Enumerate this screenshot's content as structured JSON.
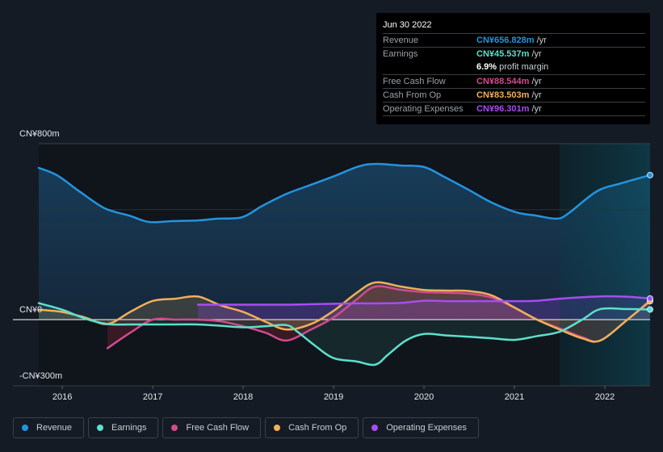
{
  "tooltip": {
    "date": "Jun 30 2022",
    "rows": [
      {
        "label": "Revenue",
        "value": "CN¥656.828m",
        "unit": " /yr",
        "color": "#2394df"
      },
      {
        "label": "Earnings",
        "value": "CN¥45.537m",
        "unit": " /yr",
        "color": "#5ce0cc"
      },
      {
        "label": "",
        "value": "6.9%",
        "unit": " profit margin",
        "color": "#ffffff"
      },
      {
        "label": "Free Cash Flow",
        "value": "CN¥88.544m",
        "unit": " /yr",
        "color": "#d14c8d"
      },
      {
        "label": "Cash From Op",
        "value": "CN¥83.503m",
        "unit": " /yr",
        "color": "#f0b05a"
      },
      {
        "label": "Operating Expenses",
        "value": "CN¥96.301m",
        "unit": " /yr",
        "color": "#a64df0"
      }
    ]
  },
  "legend": [
    {
      "label": "Revenue",
      "color": "#2394df"
    },
    {
      "label": "Earnings",
      "color": "#5ce0cc"
    },
    {
      "label": "Free Cash Flow",
      "color": "#d14c8d"
    },
    {
      "label": "Cash From Op",
      "color": "#f0b05a"
    },
    {
      "label": "Operating Expenses",
      "color": "#a64df0"
    }
  ],
  "chart_data": {
    "type": "line",
    "title": "",
    "xlabel": "",
    "ylabel": "",
    "y_tick_labels": [
      "CN¥800m",
      "CN¥0",
      "-CN¥300m"
    ],
    "ylim": [
      -300,
      800
    ],
    "xlim": [
      2015.74,
      2022.5
    ],
    "x_ticks": [
      2016,
      2017,
      2018,
      2019,
      2020,
      2021,
      2022
    ],
    "x_tick_labels": [
      "2016",
      "2017",
      "2018",
      "2019",
      "2020",
      "2021",
      "2022"
    ],
    "highlight_range": [
      2021.5,
      2022.5
    ],
    "grid": true,
    "legend_position": "bottom",
    "series": [
      {
        "name": "Revenue",
        "color": "#2394df",
        "x": [
          2015.74,
          2015.94,
          2016.2,
          2016.47,
          2016.74,
          2016.96,
          2017.23,
          2017.5,
          2017.72,
          2017.99,
          2018.21,
          2018.48,
          2018.75,
          2019.01,
          2019.28,
          2019.46,
          2019.73,
          2020.0,
          2020.22,
          2020.49,
          2020.75,
          2021.02,
          2021.24,
          2021.47,
          2021.6,
          2021.91,
          2022.18,
          2022.5
        ],
        "y": [
          690,
          657,
          580,
          506,
          473,
          444,
          448,
          451,
          459,
          466,
          517,
          572,
          613,
          653,
          697,
          708,
          701,
          694,
          650,
          591,
          532,
          488,
          473,
          459,
          484,
          583,
          620,
          657
        ]
      },
      {
        "name": "Earnings",
        "color": "#5ce0cc",
        "x": [
          2015.74,
          2016.0,
          2016.25,
          2016.5,
          2016.75,
          2017.0,
          2017.25,
          2017.5,
          2017.75,
          2018.0,
          2018.25,
          2018.48,
          2018.6,
          2018.8,
          2019.0,
          2019.25,
          2019.46,
          2019.6,
          2019.8,
          2020.0,
          2020.25,
          2020.5,
          2020.75,
          2021.0,
          2021.25,
          2021.5,
          2021.75,
          2021.95,
          2022.25,
          2022.5
        ],
        "y": [
          75,
          45,
          5,
          -20,
          -22,
          -22,
          -22,
          -22,
          -28,
          -35,
          -30,
          -25,
          -55,
          -120,
          -175,
          -190,
          -205,
          -160,
          -95,
          -65,
          -72,
          -78,
          -85,
          -92,
          -75,
          -55,
          0,
          48,
          48,
          46
        ]
      },
      {
        "name": "Free Cash Flow",
        "color": "#d14c8d",
        "x": [
          2016.5,
          2016.75,
          2017.0,
          2017.25,
          2017.5,
          2017.75,
          2018.0,
          2018.25,
          2018.48,
          2018.75,
          2019.0,
          2019.25,
          2019.46,
          2019.75,
          2020.0,
          2020.25,
          2020.5,
          2020.75,
          2021.0,
          2021.25,
          2021.5,
          2021.75,
          2021.95,
          2022.25,
          2022.5
        ],
        "y": [
          -130,
          -60,
          0,
          0,
          0,
          -8,
          -30,
          -60,
          -95,
          -45,
          10,
          90,
          150,
          135,
          125,
          122,
          118,
          100,
          55,
          0,
          -40,
          -80,
          -95,
          0,
          88
        ]
      },
      {
        "name": "Cash From Op",
        "color": "#f0b05a",
        "x": [
          2015.74,
          2016.0,
          2016.25,
          2016.5,
          2016.75,
          2017.0,
          2017.25,
          2017.5,
          2017.75,
          2018.0,
          2018.25,
          2018.48,
          2018.75,
          2019.0,
          2019.25,
          2019.46,
          2019.75,
          2020.0,
          2020.25,
          2020.5,
          2020.75,
          2021.0,
          2021.25,
          2021.5,
          2021.75,
          2021.95,
          2022.25,
          2022.5
        ],
        "y": [
          45,
          35,
          10,
          -20,
          35,
          85,
          95,
          105,
          65,
          35,
          -10,
          -45,
          -20,
          40,
          120,
          169,
          150,
          135,
          132,
          130,
          110,
          55,
          0,
          -45,
          -85,
          -95,
          0,
          84
        ]
      },
      {
        "name": "Operating Expenses",
        "color": "#a64df0",
        "x": [
          2017.5,
          2017.75,
          2018.0,
          2018.25,
          2018.5,
          2018.75,
          2019.0,
          2019.25,
          2019.5,
          2019.75,
          2020.0,
          2020.25,
          2020.5,
          2020.75,
          2021.0,
          2021.25,
          2021.5,
          2021.75,
          2022.0,
          2022.25,
          2022.5
        ],
        "y": [
          68,
          68,
          68,
          68,
          68,
          70,
          72,
          74,
          74,
          76,
          86,
          84,
          84,
          84,
          84,
          86,
          95,
          102,
          106,
          104,
          96
        ]
      }
    ]
  }
}
